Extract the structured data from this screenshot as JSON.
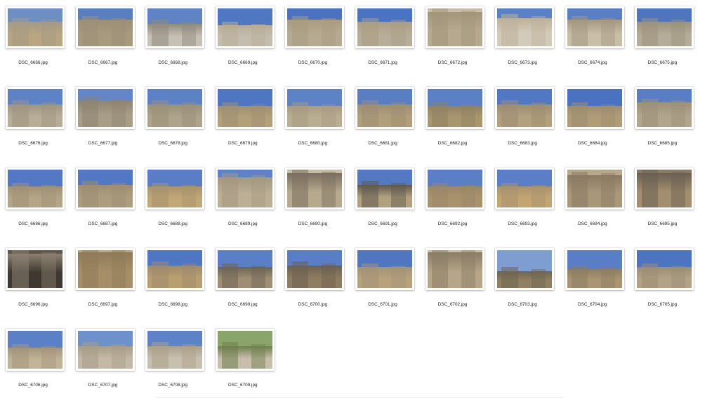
{
  "files": [
    {
      "name": "DSC_6666.jpg",
      "sky": "#6d8fc4",
      "ground": "#b9a582",
      "ruin": "#a59a85",
      "sh": 35
    },
    {
      "name": "DSC_6667.jpg",
      "sky": "#5a7fc0",
      "ground": "#a89a7d",
      "ruin": "#9b8f78",
      "sh": 30
    },
    {
      "name": "DSC_6668.jpg",
      "sky": "#5f83c5",
      "ground": "#c7c1b5",
      "ruin": "#8f8a7d",
      "sh": 40
    },
    {
      "name": "DSC_6669.jpg",
      "sky": "#4f77c2",
      "ground": "#c3bdb0",
      "ruin": "#b8ad95",
      "sh": 45
    },
    {
      "name": "DSC_6670.jpg",
      "sky": "#4a72c0",
      "ground": "#b6aa92",
      "ruin": "#a89b80",
      "sh": 30
    },
    {
      "name": "DSC_6671.jpg",
      "sky": "#4a73c3",
      "ground": "#b8ad98",
      "ruin": "#a99d85",
      "sh": 35
    },
    {
      "name": "DSC_6672.jpg",
      "sky": "#c9bea9",
      "ground": "#b6a98f",
      "ruin": "#a3957a",
      "sh": 10
    },
    {
      "name": "DSC_6673.jpg",
      "sky": "#5c80c6",
      "ground": "#d3cbba",
      "ruin": "#bdb19b",
      "sh": 25
    },
    {
      "name": "DSC_6674.jpg",
      "sky": "#5b7fc5",
      "ground": "#c8bfa9",
      "ruin": "#a49780",
      "sh": 30
    },
    {
      "name": "DSC_6675.jpg",
      "sky": "#5075bf",
      "ground": "#b5ad99",
      "ruin": "#9c927c",
      "sh": 35
    },
    {
      "name": "DSC_6676.jpg",
      "sky": "#5d82c6",
      "ground": "#b7ad99",
      "ruin": "#9f9480",
      "sh": 40
    },
    {
      "name": "DSC_6677.jpg",
      "sky": "#6286c7",
      "ground": "#a89d87",
      "ruin": "#8e8471",
      "sh": 30
    },
    {
      "name": "DSC_6678.jpg",
      "sky": "#5d81c5",
      "ground": "#aea38b",
      "ruin": "#9a8f78",
      "sh": 40
    },
    {
      "name": "DSC_6679.jpg",
      "sky": "#4e76c1",
      "ground": "#b39f79",
      "ruin": "#9f8f72",
      "sh": 45
    },
    {
      "name": "DSC_6680.jpg",
      "sky": "#5d82c5",
      "ground": "#b9ad92",
      "ruin": "#a89b82",
      "sh": 45
    },
    {
      "name": "DSC_6681.jpg",
      "sky": "#5a7ec4",
      "ground": "#b19f7c",
      "ruin": "#9d8d72",
      "sh": 40
    },
    {
      "name": "DSC_6682.jpg",
      "sky": "#5b80c6",
      "ground": "#a9966f",
      "ruin": "#8f8262",
      "sh": 45
    },
    {
      "name": "DSC_6683.jpg",
      "sky": "#5378c3",
      "ground": "#b3a07e",
      "ruin": "#9c8d72",
      "sh": 40
    },
    {
      "name": "DSC_6684.jpg",
      "sky": "#4b72c0",
      "ground": "#b09d78",
      "ruin": "#9d8c6f",
      "sh": 45
    },
    {
      "name": "DSC_6685.jpg",
      "sky": "#5a7ec4",
      "ground": "#b1a58d",
      "ruin": "#9d9079",
      "sh": 35
    },
    {
      "name": "DSC_6686.jpg",
      "sky": "#5479c4",
      "ground": "#b4a587",
      "ruin": "#a09277",
      "sh": 45
    },
    {
      "name": "DSC_6687.jpg",
      "sky": "#5277c3",
      "ground": "#ad9d7f",
      "ruin": "#9d8e73",
      "sh": 40
    },
    {
      "name": "DSC_6688.jpg",
      "sky": "#5a7ec5",
      "ground": "#c2a777",
      "ruin": "#a8926d",
      "sh": 45
    },
    {
      "name": "DSC_6689.jpg",
      "sky": "#5d82c6",
      "ground": "#bcaf96",
      "ruin": "#a59880",
      "sh": 20
    },
    {
      "name": "DSC_6690.jpg",
      "sky": "#c8bca5",
      "ground": "#b7a98d",
      "ruin": "#7a6f60",
      "sh": 10
    },
    {
      "name": "DSC_6691.jpg",
      "sky": "#5479c3",
      "ground": "#b3a07e",
      "ruin": "#5f594f",
      "sh": 40
    },
    {
      "name": "DSC_6692.jpg",
      "sky": "#5a7fc5",
      "ground": "#a8936d",
      "ruin": "#9a8769",
      "sh": 45
    },
    {
      "name": "DSC_6693.jpg",
      "sky": "#5a7fc6",
      "ground": "#c3a572",
      "ruin": "#a89270",
      "sh": 45
    },
    {
      "name": "DSC_6694.jpg",
      "sky": "#b7a88c",
      "ground": "#a99779",
      "ruin": "#8a7a62",
      "sh": 15
    },
    {
      "name": "DSC_6695.jpg",
      "sky": "#8a7c67",
      "ground": "#a38f6f",
      "ruin": "#6b6052",
      "sh": 10
    },
    {
      "name": "DSC_6696.jpg",
      "sky": "#5f5548",
      "ground": "#3f3830",
      "ruin": "#8b8172",
      "sh": 10
    },
    {
      "name": "DSC_6697.jpg",
      "sky": "#bca784",
      "ground": "#a68f68",
      "ruin": "#8f7a58",
      "sh": 5
    },
    {
      "name": "DSC_6698.jpg",
      "sky": "#4f76c2",
      "ground": "#b99f70",
      "ruin": "#9e8a6b",
      "sh": 40
    },
    {
      "name": "DSC_6699.jpg",
      "sky": "#5a7fc6",
      "ground": "#9f8e73",
      "ruin": "#6d6455",
      "sh": 45
    },
    {
      "name": "DSC_6700.jpg",
      "sky": "#5a7ec5",
      "ground": "#8f7d62",
      "ruin": "#6c6050",
      "sh": 40
    },
    {
      "name": "DSC_6701.jpg",
      "sky": "#5075c1",
      "ground": "#b7a27c",
      "ruin": "#a39276",
      "sh": 45
    },
    {
      "name": "DSC_6702.jpg",
      "sky": "#cbbda4",
      "ground": "#b6a587",
      "ruin": "#8a7d66",
      "sh": 5
    },
    {
      "name": "DSC_6703.jpg",
      "sky": "#7e9dd0",
      "ground": "#8f8061",
      "ruin": "#6f6551",
      "sh": 55
    },
    {
      "name": "DSC_6704.jpg",
      "sky": "#5a7ec5",
      "ground": "#a99572",
      "ruin": "#8d7d63",
      "sh": 50
    },
    {
      "name": "DSC_6705.jpg",
      "sky": "#4c74c1",
      "ground": "#b3a386",
      "ruin": "#9b8d75",
      "sh": 45
    },
    {
      "name": "DSC_6706.jpg",
      "sky": "#5b80c6",
      "ground": "#c1b398",
      "ruin": "#a3957c",
      "sh": 45
    },
    {
      "name": "DSC_6707.jpg",
      "sky": "#6e91cc",
      "ground": "#c3b9a6",
      "ruin": "#a89d88",
      "sh": 40
    },
    {
      "name": "DSC_6708.jpg",
      "sky": "#5d82c7",
      "ground": "#c8c0ae",
      "ruin": "#aba08a",
      "sh": 40
    },
    {
      "name": "DSC_6709.jpg",
      "sky": "#8aa56c",
      "ground": "#c8beab",
      "ruin": "#6f7f4e",
      "sh": 40
    }
  ]
}
